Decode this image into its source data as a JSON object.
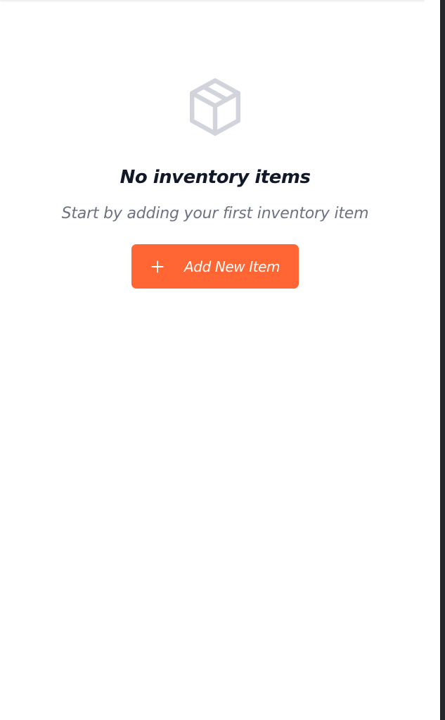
{
  "empty_state": {
    "icon": "box-icon",
    "title": "No inventory items",
    "subtitle": "Start by adding your first inventory item",
    "add_button": {
      "icon": "plus-icon",
      "label": "Add New Item"
    }
  },
  "colors": {
    "accent": "#ff6633",
    "title": "#111827",
    "subtitle": "#6b7280",
    "icon": "#d1d5db"
  }
}
